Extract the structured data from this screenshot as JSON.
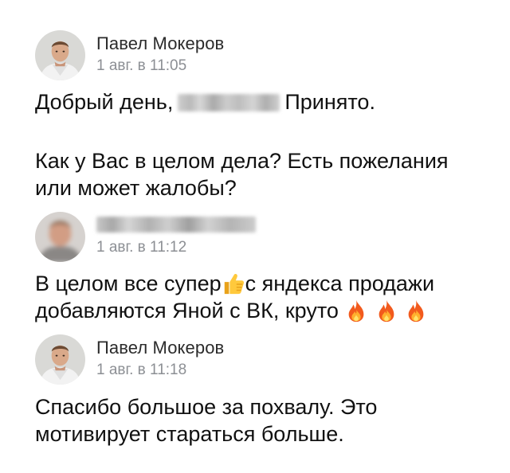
{
  "messages": [
    {
      "author": "Павел Мокеров",
      "time": "1 авг. в 11:05",
      "text_prefix": "Добрый день,",
      "text_after_blur": "Принято.",
      "text_para2": "Как у Вас в целом дела? Есть пожелания или может жалобы?"
    },
    {
      "author": "",
      "time": "1 авг. в 11:12",
      "text_line1_a": "В целом все супер",
      "text_line1_b": "с яндекса продажи",
      "text_line2": "добавляются Яной с ВК, круто"
    },
    {
      "author": "Павел Мокеров",
      "time": "1 авг. в 11:18",
      "text": "Спасибо большое за похвалу. Это мотивирует стараться больше."
    }
  ],
  "icons": {
    "thumbs_up": "thumbs-up-emoji",
    "fire": "fire-emoji"
  },
  "colors": {
    "name": "#2b2b2b",
    "time": "#8c8f94",
    "text": "#111111"
  }
}
